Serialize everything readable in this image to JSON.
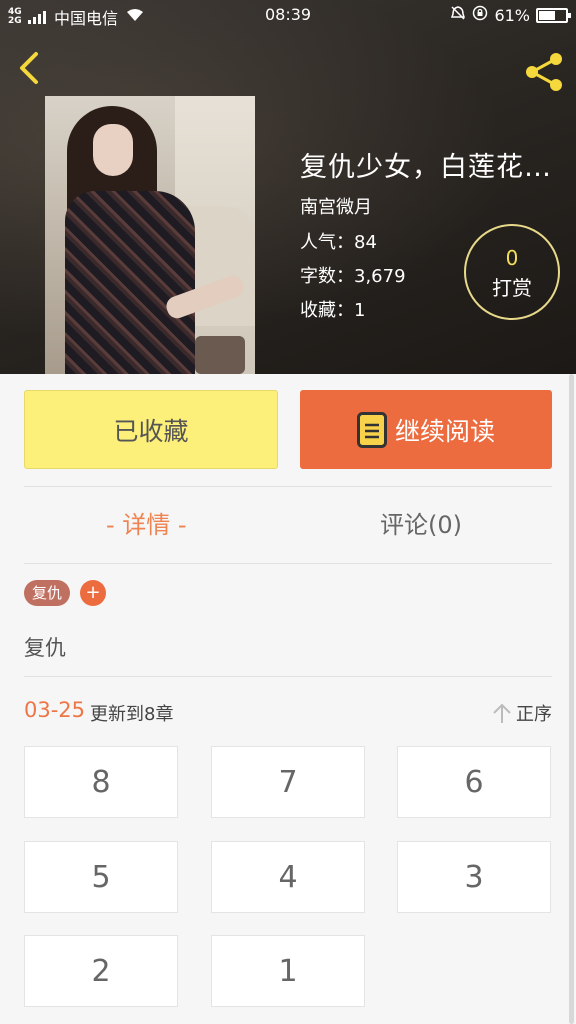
{
  "status_bar": {
    "network": "4G 2G",
    "carrier": "中国电信",
    "time": "08:39",
    "battery": "61%",
    "battery_level": 0.61
  },
  "book": {
    "title": "复仇少女，白莲花请...",
    "author": "南宫微月",
    "popularity": "人气：84",
    "word_count": "字数：3,679",
    "favorites": "收藏：1"
  },
  "reward": {
    "count": "0",
    "label": "打赏"
  },
  "actions": {
    "favorited_label": "已收藏",
    "continue_label": "继续阅读"
  },
  "tabs": {
    "detail": "- 详情 -",
    "comments": "评论(0)"
  },
  "tags": {
    "items": [
      "复仇"
    ],
    "add": "+"
  },
  "description": "复仇",
  "updates": {
    "date": "03-25",
    "text": "更新到8章",
    "sort_label": "正序"
  },
  "chapters": [
    "8",
    "7",
    "6",
    "5",
    "4",
    "3",
    "2",
    "1"
  ],
  "colors": {
    "accent": "#ec6c40",
    "favorite_bg": "#fdf07a",
    "reward_ring": "#e8d98a"
  }
}
